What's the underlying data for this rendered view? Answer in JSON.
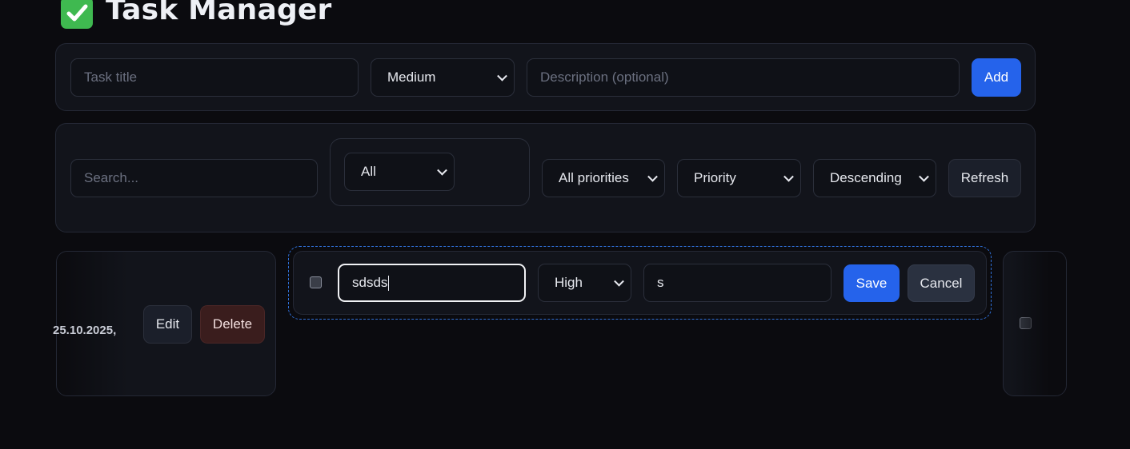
{
  "app": {
    "title": "Task Manager",
    "title_icon": "check-mark-button-icon"
  },
  "add_form": {
    "title_placeholder": "Task title",
    "priority_value": "Medium",
    "description_placeholder": "Description (optional)",
    "add_label": "Add"
  },
  "filters": {
    "search_placeholder": "Search...",
    "status_value": "All",
    "priority_filter_value": "All priorities",
    "sort_by_value": "Priority",
    "sort_order_value": "Descending",
    "refresh_label": "Refresh"
  },
  "tasks": {
    "left_card": {
      "date_text": "25.10.2025,",
      "edit_label": "Edit",
      "delete_label": "Delete"
    },
    "editing": {
      "title_value": "sdsds",
      "priority_value": "High",
      "description_value": "s",
      "save_label": "Save",
      "cancel_label": "Cancel"
    }
  },
  "colors": {
    "background": "#0b0b0f",
    "panel": "#12141b",
    "accent": "#2563eb",
    "delete": "#3a1d1d",
    "check_icon": "#3fb950"
  }
}
